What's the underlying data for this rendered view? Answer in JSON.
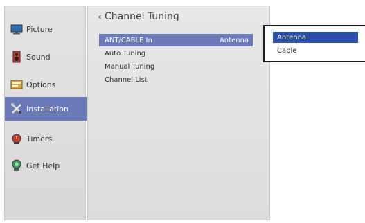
{
  "sidebar": {
    "items": [
      {
        "label": "Picture",
        "icon": "picture-icon"
      },
      {
        "label": "Sound",
        "icon": "speaker-icon"
      },
      {
        "label": "Options",
        "icon": "options-icon"
      },
      {
        "label": "Installation",
        "icon": "tools-icon",
        "selected": true
      },
      {
        "label": "Timers",
        "icon": "timer-icon"
      },
      {
        "label": "Get Help",
        "icon": "help-icon"
      }
    ]
  },
  "main": {
    "title": "Channel Tuning",
    "back_glyph": "‹",
    "menu": [
      {
        "label": "ANT/CABLE In",
        "value": "Antenna",
        "selected": true
      },
      {
        "label": "Auto Tuning",
        "value": ""
      },
      {
        "label": "Manual Tuning",
        "value": ""
      },
      {
        "label": "Channel List",
        "value": ""
      }
    ]
  },
  "popup": {
    "options": [
      {
        "label": "Antenna",
        "selected": true
      },
      {
        "label": "Cable",
        "selected": false
      }
    ]
  },
  "colors": {
    "selection": "#6a7ab8",
    "popup_selection": "#2a4faa"
  }
}
